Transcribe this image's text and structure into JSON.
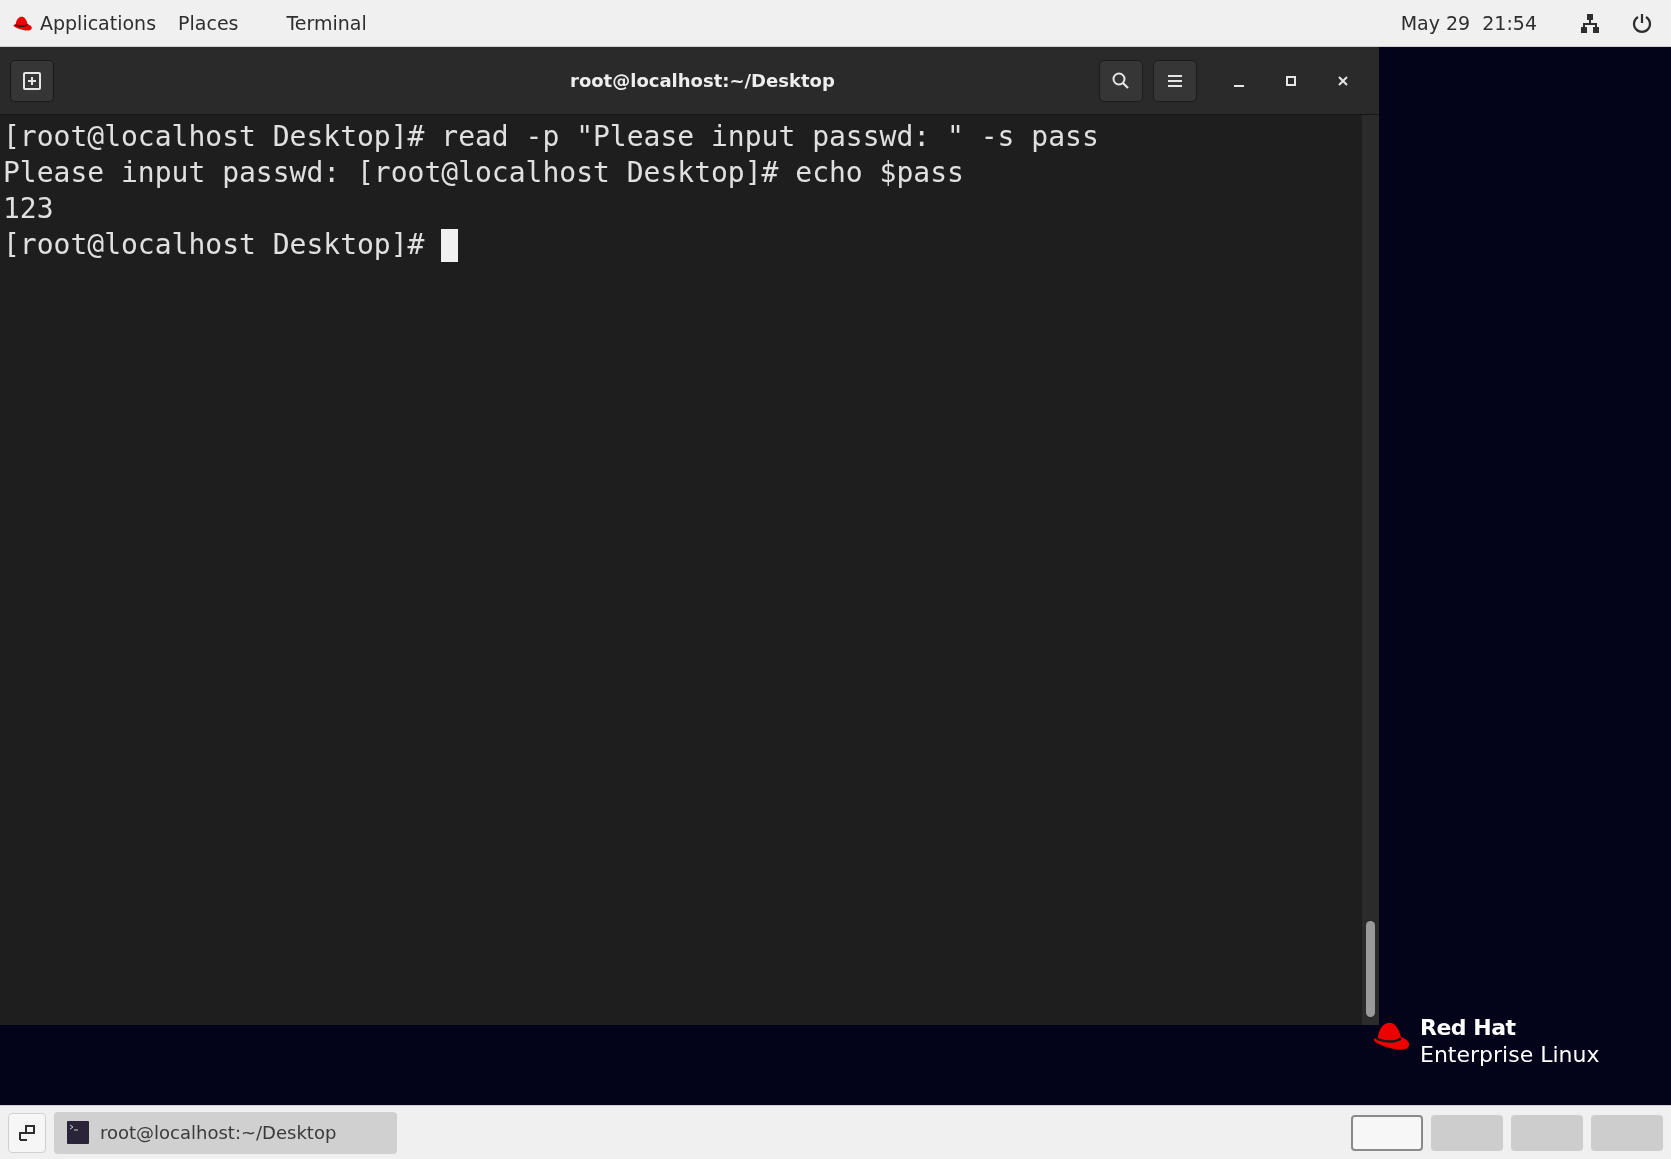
{
  "top_bar": {
    "menus": [
      "Applications",
      "Places",
      "Terminal"
    ],
    "clock": "May 29  21:54"
  },
  "terminal": {
    "title": "root@localhost:~/Desktop",
    "lines": [
      "[root@localhost Desktop]# read -p \"Please input passwd: \" -s pass",
      "Please input passwd: [root@localhost Desktop]# echo $pass",
      "123",
      "[root@localhost Desktop]# "
    ],
    "cursor": true
  },
  "desktop_logo": {
    "brand": "Red Hat",
    "product": "Enterprise Linux"
  },
  "taskbar": {
    "windows": [
      {
        "label": "root@localhost:~/Desktop",
        "selected": false
      }
    ],
    "workspaces": [
      {
        "selected": true
      },
      {
        "selected": false
      },
      {
        "selected": false
      },
      {
        "selected": false
      }
    ]
  }
}
